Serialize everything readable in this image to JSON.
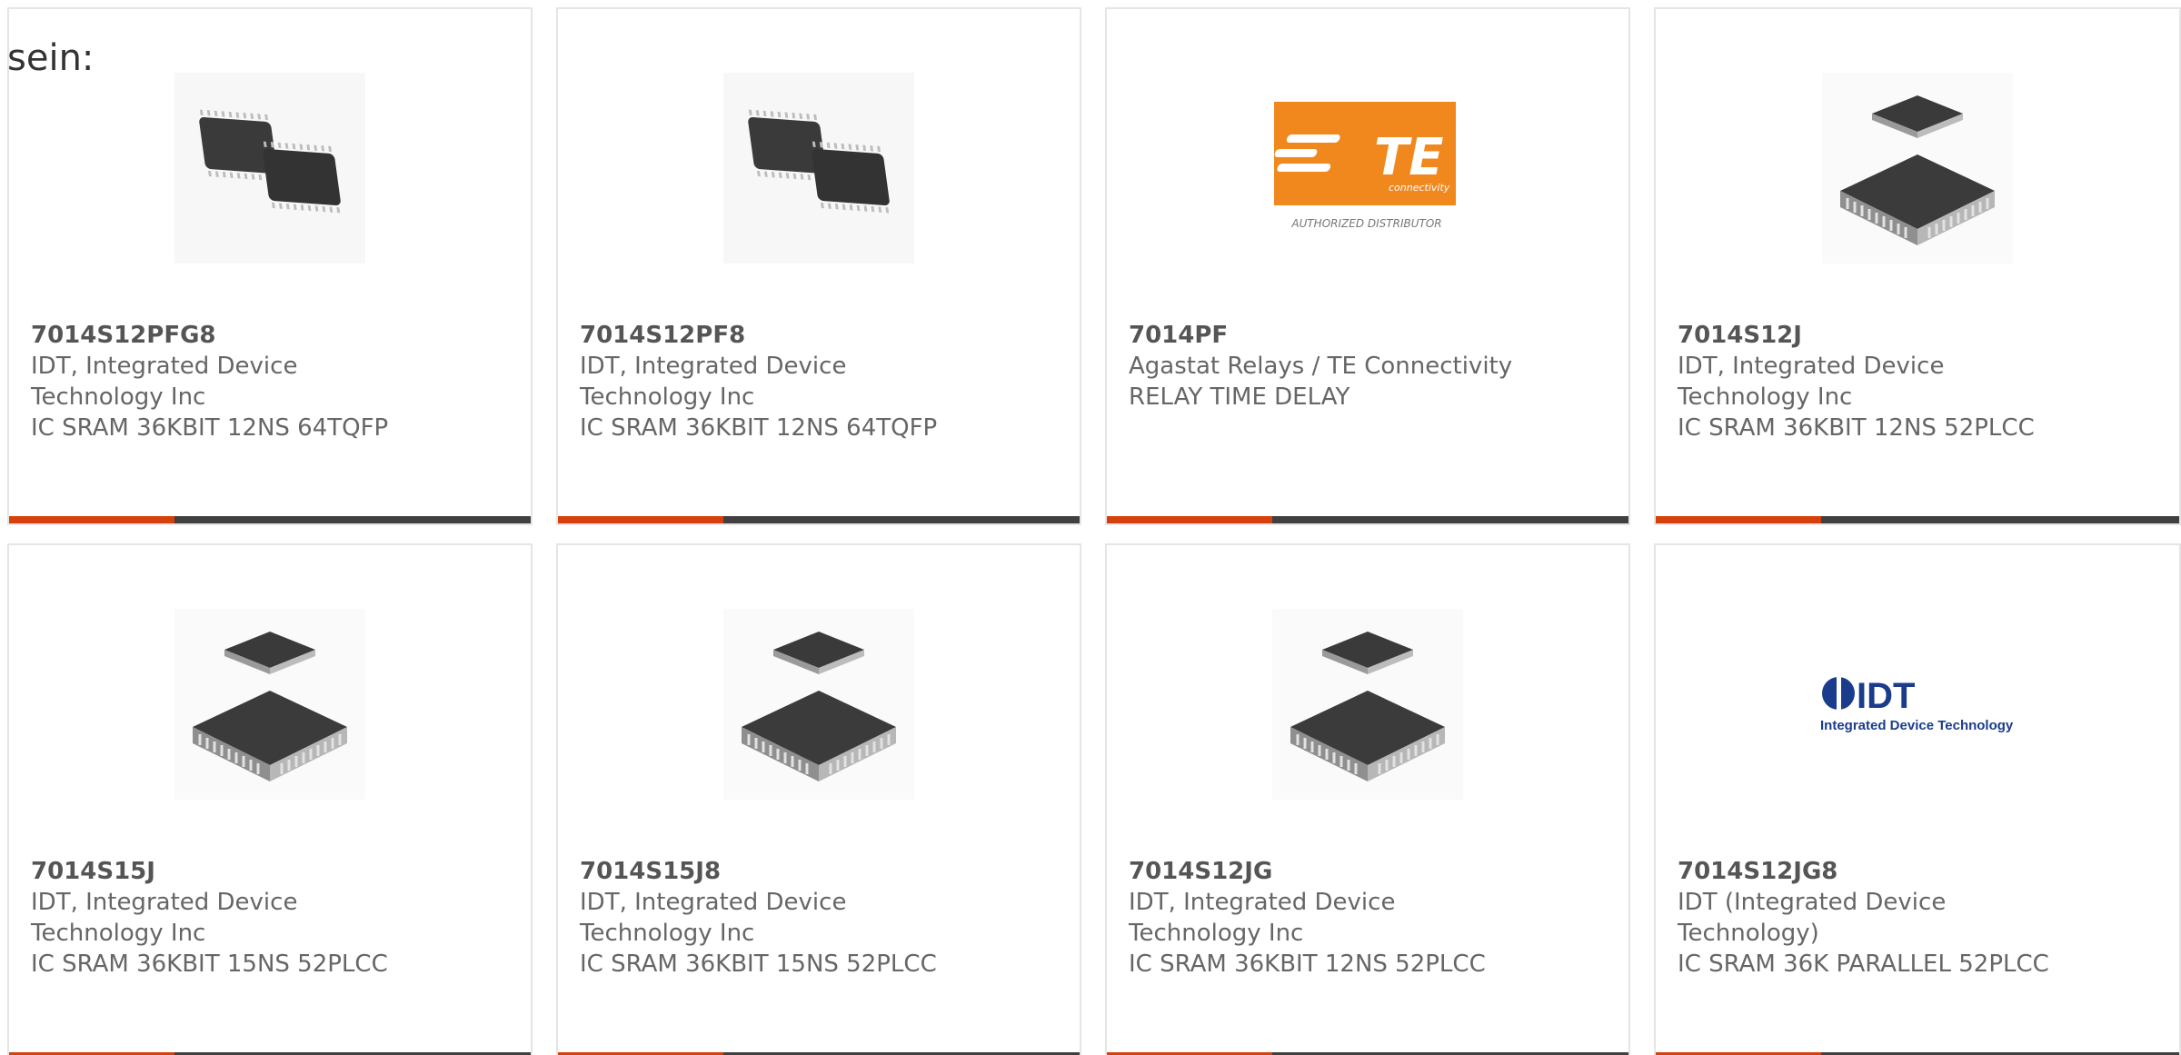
{
  "intro": {
    "text": "sein:"
  },
  "colors": {
    "accent_bar": "#d6400a",
    "bar": "#404040",
    "card_border": "#e5e5e5",
    "te_orange": "#f0881e",
    "idt_blue": "#1b3c8c"
  },
  "products": [
    {
      "part_number": "7014S12PFG8",
      "manufacturer": "IDT, Integrated Device Technology Inc",
      "manufacturer_line1": "IDT, Integrated Device",
      "manufacturer_line2": "Technology Inc",
      "description": "IC SRAM 36KBIT 12NS 64TQFP",
      "image": "tqfp-chip-pair-icon"
    },
    {
      "part_number": "7014S12PF8",
      "manufacturer": "IDT, Integrated Device Technology Inc",
      "manufacturer_line1": "IDT, Integrated Device",
      "manufacturer_line2": "Technology Inc",
      "description": "IC SRAM 36KBIT 12NS 64TQFP",
      "image": "tqfp-chip-pair-icon"
    },
    {
      "part_number": "7014PF",
      "manufacturer_line1": "Agastat Relays / TE Connectivity",
      "description": "RELAY TIME DELAY",
      "image": "te-connectivity-logo",
      "logo_text": "TE",
      "logo_sub": "connectivity",
      "logo_caption": "AUTHORIZED DISTRIBUTOR"
    },
    {
      "part_number": "7014S12J",
      "manufacturer_line1": "IDT, Integrated Device",
      "manufacturer_line2": "Technology Inc",
      "description": "IC SRAM 36KBIT 12NS 52PLCC",
      "image": "plcc-chip-icon"
    },
    {
      "part_number": "7014S15J",
      "manufacturer_line1": "IDT, Integrated Device",
      "manufacturer_line2": "Technology Inc",
      "description": "IC SRAM 36KBIT 15NS 52PLCC",
      "image": "plcc-chip-icon"
    },
    {
      "part_number": "7014S15J8",
      "manufacturer_line1": "IDT, Integrated Device",
      "manufacturer_line2": "Technology Inc",
      "description": "IC SRAM 36KBIT 15NS 52PLCC",
      "image": "plcc-chip-icon"
    },
    {
      "part_number": "7014S12JG",
      "manufacturer_line1": "IDT, Integrated Device",
      "manufacturer_line2": "Technology Inc",
      "description": "IC SRAM 36KBIT 12NS 52PLCC",
      "image": "plcc-chip-icon"
    },
    {
      "part_number": "7014S12JG8",
      "manufacturer_line1": "IDT (Integrated Device",
      "manufacturer_line2": "Technology)",
      "description": "IC SRAM 36K PARALLEL 52PLCC",
      "image": "idt-logo",
      "logo_text": "IDT",
      "logo_sub": "Integrated Device Technology"
    }
  ]
}
